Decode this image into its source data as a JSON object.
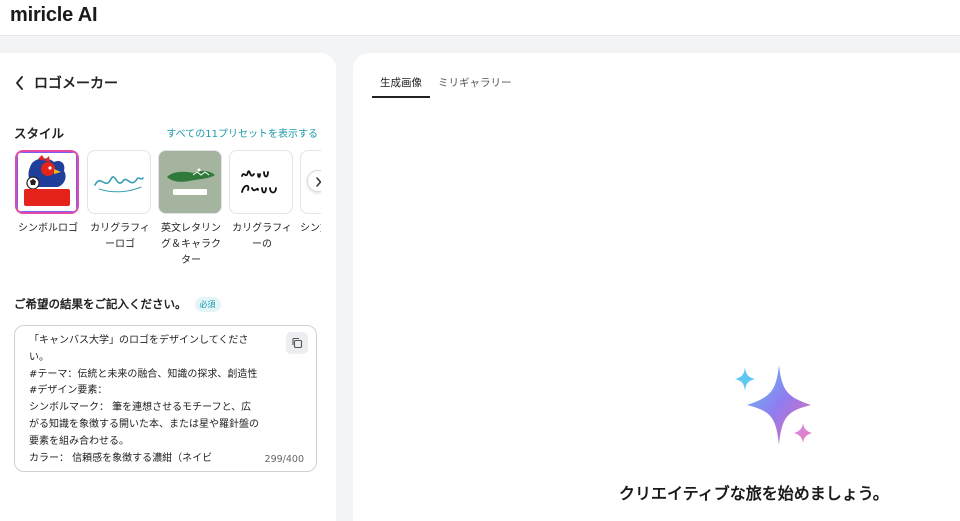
{
  "app": {
    "logo": "miricle AI"
  },
  "left": {
    "back_title": "ロゴメーカー",
    "style_label": "スタイル",
    "preset_link": "すべての11プリセットを表示する",
    "presets": [
      {
        "label": "シンボルロゴ",
        "thumb_text": "ミリFC",
        "selected": true
      },
      {
        "label": "カリグラフィーロゴ",
        "thumb_text": "デザインハブ"
      },
      {
        "label": "英文レタリング＆キャラクター",
        "thumb_text": "MIRIDIH"
      },
      {
        "label": "カリグラフィーの",
        "thumb_text": "Miri Canvas"
      },
      {
        "label": "シン文L"
      }
    ],
    "prompt_label": "ご希望の結果をご記入ください。",
    "required_badge": "必須",
    "prompt_text": "「キャンバス大学」のロゴをデザインしてください。\n#テーマ：伝統と未来の融合、知識の探求、創造性\n#デザイン要素：\nシンボルマーク： 筆を連想させるモチーフと、広がる知識を象徴する開いた本、または星や羅針盤の要素を組み合わせる。\nカラー： 信頼感を象徴する濃紺（ネイビ",
    "counter": "299/400"
  },
  "right": {
    "tabs": [
      "生成画像",
      "ミリギャラリー"
    ],
    "active_tab": 0,
    "empty_message": "クリエイティブな旅を始めましょう。"
  },
  "colors": {
    "accent": "#1a9aa8",
    "selected_border": "#e24aa5"
  }
}
